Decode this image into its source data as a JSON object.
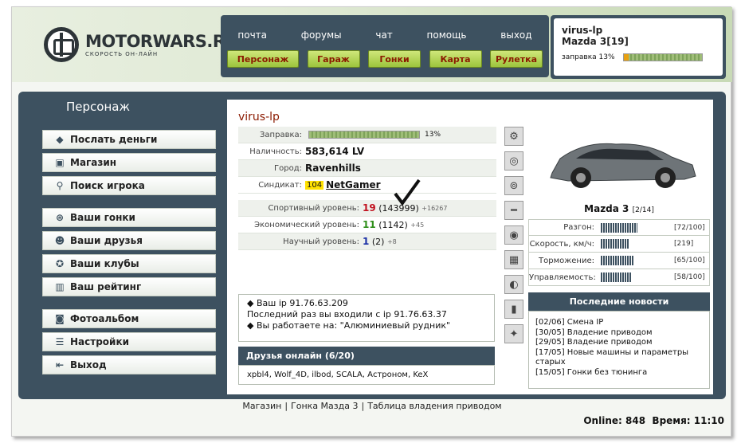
{
  "logo": {
    "title": "MOTORWARS.RU",
    "subtitle": "СКОРОСТЬ ОН-ЛАЙН"
  },
  "topnav": [
    "почта",
    "форумы",
    "чат",
    "помощь",
    "выход"
  ],
  "gamenav": [
    "Персонаж",
    "Гараж",
    "Гонки",
    "Карта",
    "Рулетка"
  ],
  "user": {
    "name": "virus-lp",
    "car": "Mazda 3[19]",
    "fuel_label": "заправка 13%",
    "fuel": 0.13
  },
  "sidebar": {
    "title": "Персонаж",
    "items": [
      "Послать деньги",
      "Магазин",
      "Поиск игрока",
      "Ваши гонки",
      "Ваши друзья",
      "Ваши клубы",
      "Ваш рейтинг",
      "Фотоальбом",
      "Настройки",
      "Выход"
    ]
  },
  "profile": {
    "name": "virus-lp",
    "fuel_label": "Заправка:",
    "fuel_pct": "13%",
    "cash_label": "Наличность:",
    "cash": "583,614 LV",
    "city_label": "Город:",
    "city": "Ravenhills",
    "syndicate_label": "Синдикат:",
    "syndicate_num": "104",
    "syndicate": "NetGamer"
  },
  "levels": [
    {
      "label": "Спортивный уровень:",
      "level": "19",
      "points": "(143999)",
      "delta": "+16267"
    },
    {
      "label": "Экономический уровень:",
      "level": "11",
      "points": "(1142)",
      "delta": "+45"
    },
    {
      "label": "Научный уровень:",
      "level": "1",
      "points": "(2)",
      "delta": "+8"
    }
  ],
  "ipinfo": [
    "Ваш ip 91.76.63.209",
    "Последний раз вы входили с ip 91.76.63.37",
    "Вы работаете на: \"Алюминиевый рудник\""
  ],
  "friends": {
    "title": "Друзья онлайн (6/20)",
    "list": "xpbl4, Wolf_4D, ilbod, SCALA, Астроном, KeX"
  },
  "car": {
    "name": "Mazda 3",
    "count": "[2/14]",
    "stats": [
      {
        "label": "Разгон:",
        "value": "[72/100]",
        "level": 0.72
      },
      {
        "label": "Скорость, км/ч:",
        "value": "[219]",
        "level": 0.62
      },
      {
        "label": "Торможение:",
        "value": "[65/100]",
        "level": 0.65
      },
      {
        "label": "Управляемость:",
        "value": "[58/100]",
        "level": 0.58
      }
    ]
  },
  "news": {
    "title": "Последние новости",
    "items": [
      "[02/06] Смена IP",
      "[30/05] Владение приводом",
      "[29/05] Владение приводом",
      "[17/05] Новые машины и параметры старых",
      "[15/05] Гонки без тюнинга"
    ]
  },
  "footer": {
    "links": [
      "Магазин",
      "Гонка Мазда 3",
      "Таблица владения приводом"
    ],
    "online_label": "Online:",
    "online": "848",
    "time_label": "Время:",
    "time": "11:10"
  }
}
